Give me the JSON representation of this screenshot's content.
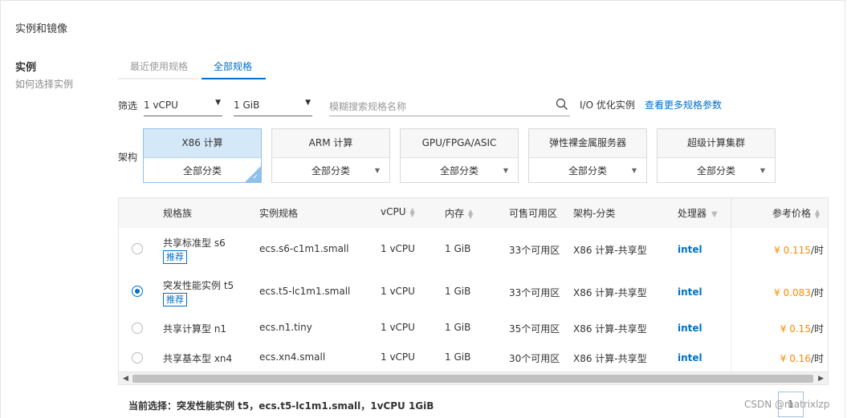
{
  "section": {
    "title": "实例和镜像"
  },
  "sidebar": {
    "title": "实例",
    "link": "如何选择实例"
  },
  "tabs": [
    {
      "label": "最近使用规格",
      "active": false
    },
    {
      "label": "全部规格",
      "active": true
    }
  ],
  "filters": {
    "label": "筛选",
    "vcpu": "1 vCPU",
    "memory": "1 GiB",
    "search_placeholder": "模糊搜索规格名称",
    "io_optimized": "I/O 优化实例",
    "more_link": "查看更多规格参数"
  },
  "architecture": {
    "label": "架构",
    "cards": [
      {
        "name": "X86 计算",
        "category": "全部分类",
        "selected": true
      },
      {
        "name": "ARM 计算",
        "category": "全部分类",
        "selected": false
      },
      {
        "name": "GPU/FPGA/ASIC",
        "category": "全部分类",
        "selected": false
      },
      {
        "name": "弹性裸金属服务器",
        "category": "全部分类",
        "selected": false
      },
      {
        "name": "超级计算集群",
        "category": "全部分类",
        "selected": false
      }
    ]
  },
  "table": {
    "headers": {
      "family": "规格族",
      "spec": "实例规格",
      "vcpu": "vCPU",
      "memory": "内存",
      "zones": "可售可用区",
      "arch": "架构-分类",
      "cpu": "处理器",
      "price": "参考价格"
    },
    "rows": [
      {
        "family": "共享标准型 s6",
        "badge": "推荐",
        "spec": "ecs.s6-c1m1.small",
        "vcpu": "1 vCPU",
        "memory": "1 GiB",
        "zones": "33个可用区",
        "arch": "X86 计算-共享型",
        "cpu": "intel",
        "price": "¥ 0.115",
        "unit": "/时",
        "selected": false
      },
      {
        "family": "突发性能实例 t5",
        "badge": "推荐",
        "spec": "ecs.t5-lc1m1.small",
        "vcpu": "1 vCPU",
        "memory": "1 GiB",
        "zones": "33个可用区",
        "arch": "X86 计算-共享型",
        "cpu": "intel",
        "price": "¥ 0.083",
        "unit": "/时",
        "selected": true
      },
      {
        "family": "共享计算型 n1",
        "badge": "",
        "spec": "ecs.n1.tiny",
        "vcpu": "1 vCPU",
        "memory": "1 GiB",
        "zones": "35个可用区",
        "arch": "X86 计算-共享型",
        "cpu": "intel",
        "price": "¥ 0.15",
        "unit": "/时",
        "selected": false
      },
      {
        "family": "共享基本型 xn4",
        "badge": "",
        "spec": "ecs.xn4.small",
        "vcpu": "1 vCPU",
        "memory": "1 GiB",
        "zones": "30个可用区",
        "arch": "X86 计算-共享型",
        "cpu": "intel",
        "price": "¥ 0.16",
        "unit": "/时",
        "selected": false
      }
    ]
  },
  "current_selection": "当前选择：突发性能实例 t5，ecs.t5-lc1m1.small，1vCPU 1GiB",
  "watermark": "CSDN @matrixlzp",
  "page_number": "1"
}
